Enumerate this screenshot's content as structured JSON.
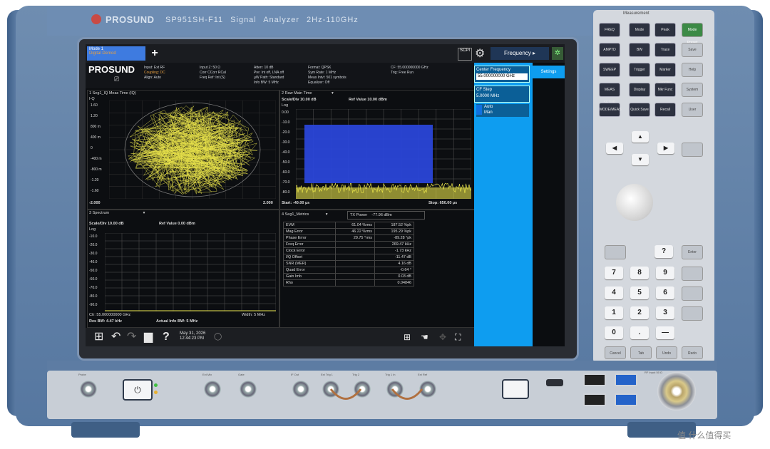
{
  "device": {
    "brand": "PROSUND",
    "model_line": "SP951SH-F11 Signal Analyzer 2Hz-110GHz"
  },
  "screen": {
    "tab": {
      "line1": "Mode 1",
      "line2": "Digital Demod"
    },
    "scpi_label": "SCPI",
    "frequency_menu": "Frequency",
    "logo": "PROSUND",
    "info": {
      "col1": [
        "Input: Ext RF",
        "Coupling: DC",
        "Align: Auto"
      ],
      "col2": [
        "Input Z: 50 Ω",
        "Corr CCorr RCal",
        "Freq Ref: Int (S)"
      ],
      "col3": [
        "Atten: 10 dB",
        "Pre: Int off, LNA off",
        "µW Path: Standard",
        "Info BW: 5 MHz"
      ],
      "col4": [
        "Format: QPSK",
        "Sym Rate: 1 MHz",
        "Meas Intvl: 501 symbols",
        "Equalizer: Off"
      ],
      "col5": [
        "CF: 55.000000000 GHz",
        "Trig: Free Run"
      ]
    },
    "freq_panel": {
      "center_label": "Center Frequency",
      "center_value": "55.000000000 GHz",
      "step_label": "CF Step",
      "step_value": "5.0000 MHz",
      "auto": "Auto",
      "man": "Man",
      "settings": "Settings"
    },
    "win1": {
      "title": "1 Seg1_IQ Meas Time (IQ)",
      "axis_top": "I-Q",
      "x_left": "-2.000",
      "x_right": "2.000",
      "yticks": [
        "1.60",
        "1.20",
        "800 m",
        "400 m",
        "0",
        "-400 m",
        "-800 m",
        "-1.20",
        "-1.60"
      ]
    },
    "win2": {
      "title": "2 Raw Main Time",
      "scale": "Scale/Div 10.00 dB",
      "ref": "Ref Value 10.00 dBm",
      "log": "Log",
      "yticks": [
        "0.00",
        "-10.0",
        "-20.0",
        "-30.0",
        "-40.0",
        "-50.0",
        "-60.0",
        "-70.0",
        "-80.0"
      ],
      "start": "Start: -40.00 µs",
      "stop": "Stop: 650.00 µs"
    },
    "win3": {
      "title": "3 Spectrum",
      "scale": "Scale/Div 10.00 dB",
      "ref": "Ref Value 0.00 dBm",
      "log": "Log",
      "yticks": [
        "-10.0",
        "-20.0",
        "-30.0",
        "-40.0",
        "-50.0",
        "-60.0",
        "-70.0",
        "-80.0",
        "-90.0"
      ],
      "cf": "Ctr: 55.000000000 GHz",
      "width": "Width: 5 MHz",
      "resbw": "Res BW: 4.47 kHz",
      "actbw": "Actual Info BW: 5 MHz"
    },
    "win4": {
      "title": "4 Seg1_Metrics",
      "txpower_label": "TX Power",
      "txpower_value": "-77.96 dBm",
      "rows": [
        [
          "EVM",
          "61.04 %rms",
          "187.52 %pk"
        ],
        [
          "Mag Error",
          "46.22 %rms",
          "195.29 %pk"
        ],
        [
          "Phase Error",
          "29.75 °rms",
          "-89.28 °pk"
        ],
        [
          "Freq Error",
          "",
          "269.47 kHz"
        ],
        [
          "Clock Error",
          "",
          "-1.73 kHz"
        ],
        [
          "I/Q Offset",
          "",
          "-11.47 dB"
        ],
        [
          "SNR (MER)",
          "",
          "4.16 dB"
        ],
        [
          "Quad Error",
          "",
          "-0.64 °"
        ],
        [
          "Gain Imb",
          "",
          "0.03 dB"
        ],
        [
          "Rho",
          "",
          "0.04846"
        ]
      ]
    },
    "taskbar": {
      "date": "May 31, 2026",
      "time": "12:44:23 PM"
    }
  },
  "keypanel": {
    "measurement_label": "Measurement",
    "meas_keys": [
      "FREQ",
      "Mode",
      "Peak Search",
      "AMPTD",
      "BW",
      "Trace",
      "SWEEP",
      "Trigger",
      "Marker Function",
      "MEAS SETUP",
      "Display",
      "Mkr Func",
      "MODE/MEAS",
      "Quick Save",
      "Recall"
    ],
    "side_keys": [
      "Mode Preset",
      "Save",
      "Help",
      "System",
      "User"
    ],
    "arrows": [
      "▲",
      "◀",
      "▶",
      "▼"
    ],
    "digits": [
      "7",
      "8",
      "9",
      "4",
      "5",
      "6",
      "1",
      "2",
      "3",
      "0",
      ".",
      "—"
    ],
    "help_glyph": "?",
    "enter_label": "Enter",
    "bottom_keys": [
      "Cancel",
      "Tab",
      "Undo",
      "Redo"
    ]
  },
  "front": {
    "power_glyph": "⏻",
    "ports": [
      "Probe",
      "Ext Mix",
      "Gate",
      "IF Out",
      "Ext Trig 1",
      "Trig 2",
      "Trig 1 In",
      "Ext Ref",
      "RF Input"
    ],
    "rf_input_note": "50 Ω"
  },
  "watermark": "值 什么值得买"
}
